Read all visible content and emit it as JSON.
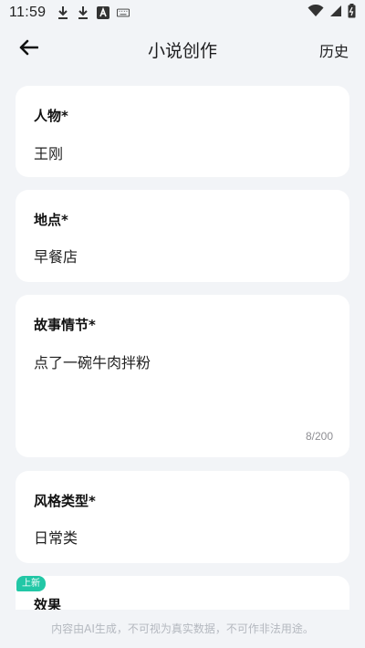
{
  "status_bar": {
    "time": "11:59",
    "left_icons": [
      "download-icon",
      "download-icon",
      "a-square-icon",
      "keyboard-icon"
    ],
    "right_icons": [
      "wifi-icon",
      "cellular-signal-icon",
      "battery-icon"
    ]
  },
  "nav": {
    "title": "小说创作",
    "back_icon": "arrow-left-icon",
    "history_label": "历史"
  },
  "form": {
    "character": {
      "label": "人物*",
      "value": "王刚"
    },
    "location": {
      "label": "地点*",
      "value": "早餐店"
    },
    "plot": {
      "label": "故事情节*",
      "value": "点了一碗牛肉拌粉",
      "counter": "8/200"
    },
    "style": {
      "label": "风格类型*",
      "value": "日常类"
    },
    "effect": {
      "badge": "上新",
      "label": "效果"
    }
  },
  "footer": {
    "note": "内容由AI生成，不可视为真实数据，不可作非法用途。"
  },
  "colors": {
    "background": "#f2f4f7",
    "card": "#ffffff",
    "badge": "#22c7a6",
    "muted": "#8e8e93"
  }
}
